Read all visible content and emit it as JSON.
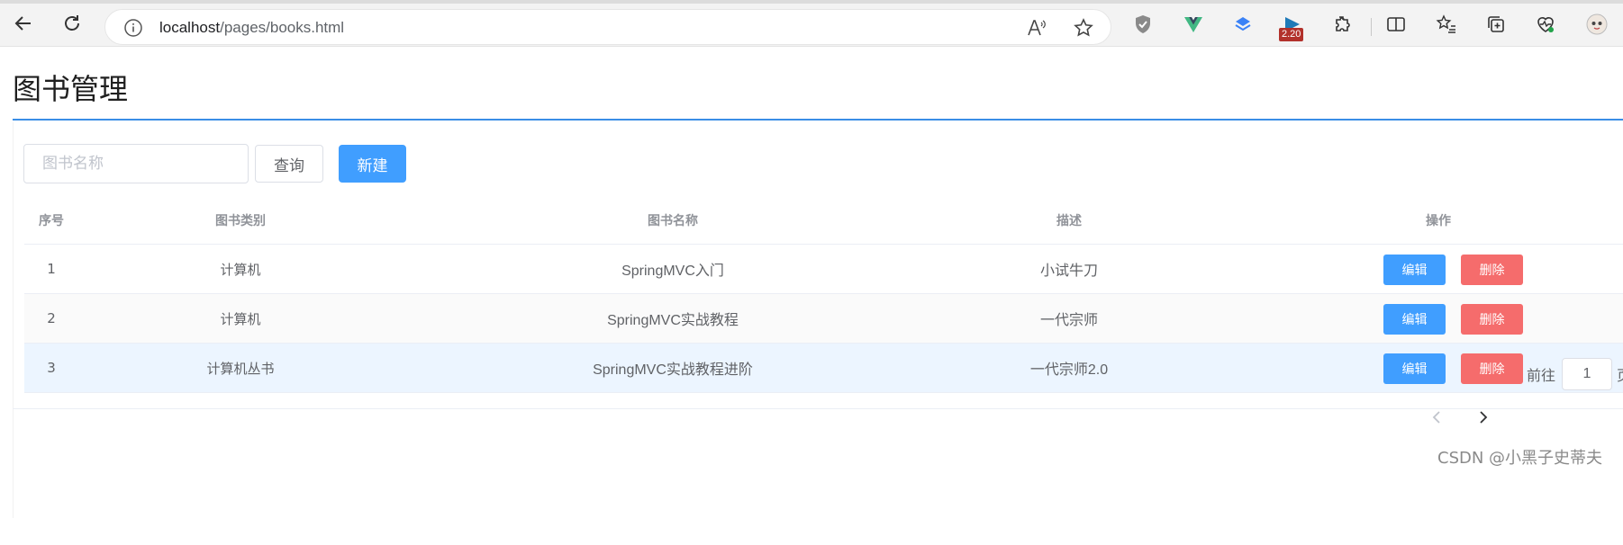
{
  "browser": {
    "url_host": "localhost",
    "url_path": "/pages/books.html",
    "extension_badge": "2.20"
  },
  "page": {
    "title": "图书管理"
  },
  "toolbar": {
    "search_placeholder": "图书名称",
    "query_label": "查询",
    "new_label": "新建"
  },
  "table": {
    "headers": {
      "index": "序号",
      "category": "图书类别",
      "name": "图书名称",
      "description": "描述",
      "actions": "操作"
    },
    "rows": [
      {
        "index": "1",
        "category": "计算机",
        "name": "SpringMVC入门",
        "description": "小试牛刀"
      },
      {
        "index": "2",
        "category": "计算机",
        "name": "SpringMVC实战教程",
        "description": "一代宗师"
      },
      {
        "index": "3",
        "category": "计算机丛书",
        "name": "SpringMVC实战教程进阶",
        "description": "一代宗师2.0"
      }
    ],
    "edit_label": "编辑",
    "delete_label": "删除"
  },
  "pagination": {
    "goto_label": "前往",
    "page_value": "1",
    "suffix": "页"
  },
  "watermark": "CSDN @小黑子史蒂夫"
}
